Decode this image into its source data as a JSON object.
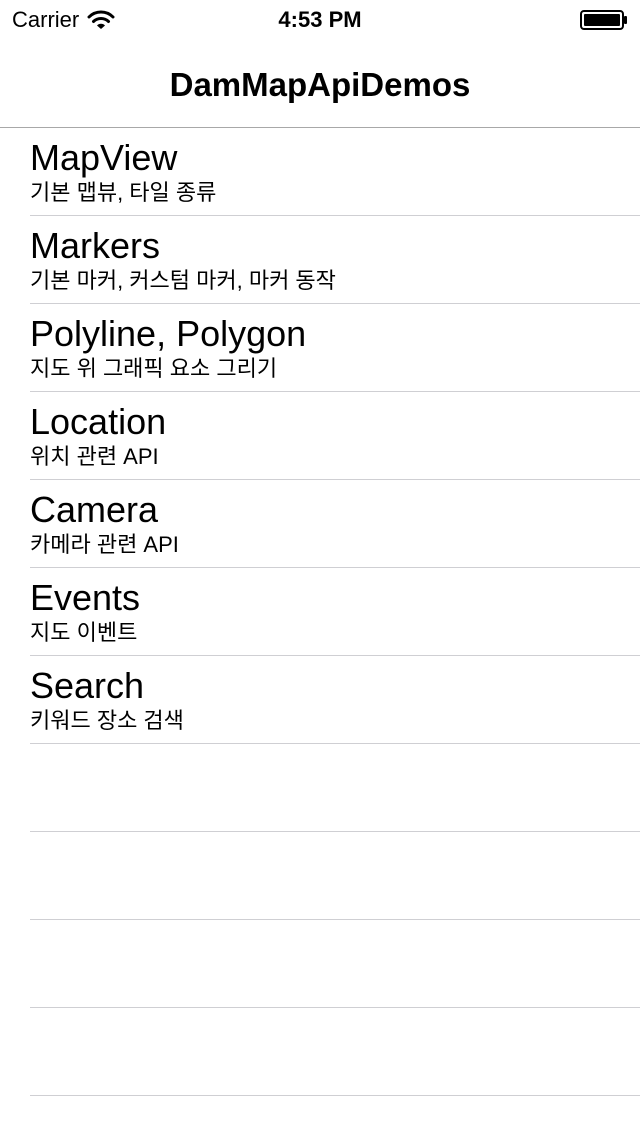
{
  "status_bar": {
    "carrier": "Carrier",
    "time": "4:53 PM",
    "wifi_icon": "wifi-icon",
    "battery_icon": "battery-icon"
  },
  "nav": {
    "title": "DamMapApiDemos"
  },
  "items": [
    {
      "title": "MapView",
      "subtitle": "기본 맵뷰, 타일 종류"
    },
    {
      "title": "Markers",
      "subtitle": "기본 마커, 커스텀 마커, 마커 동작"
    },
    {
      "title": "Polyline, Polygon",
      "subtitle": "지도 위 그래픽 요소 그리기"
    },
    {
      "title": "Location",
      "subtitle": "위치 관련 API"
    },
    {
      "title": "Camera",
      "subtitle": "카메라 관련 API"
    },
    {
      "title": "Events",
      "subtitle": "지도 이벤트"
    },
    {
      "title": "Search",
      "subtitle": "키워드 장소 검색"
    }
  ],
  "empty_rows": 4
}
